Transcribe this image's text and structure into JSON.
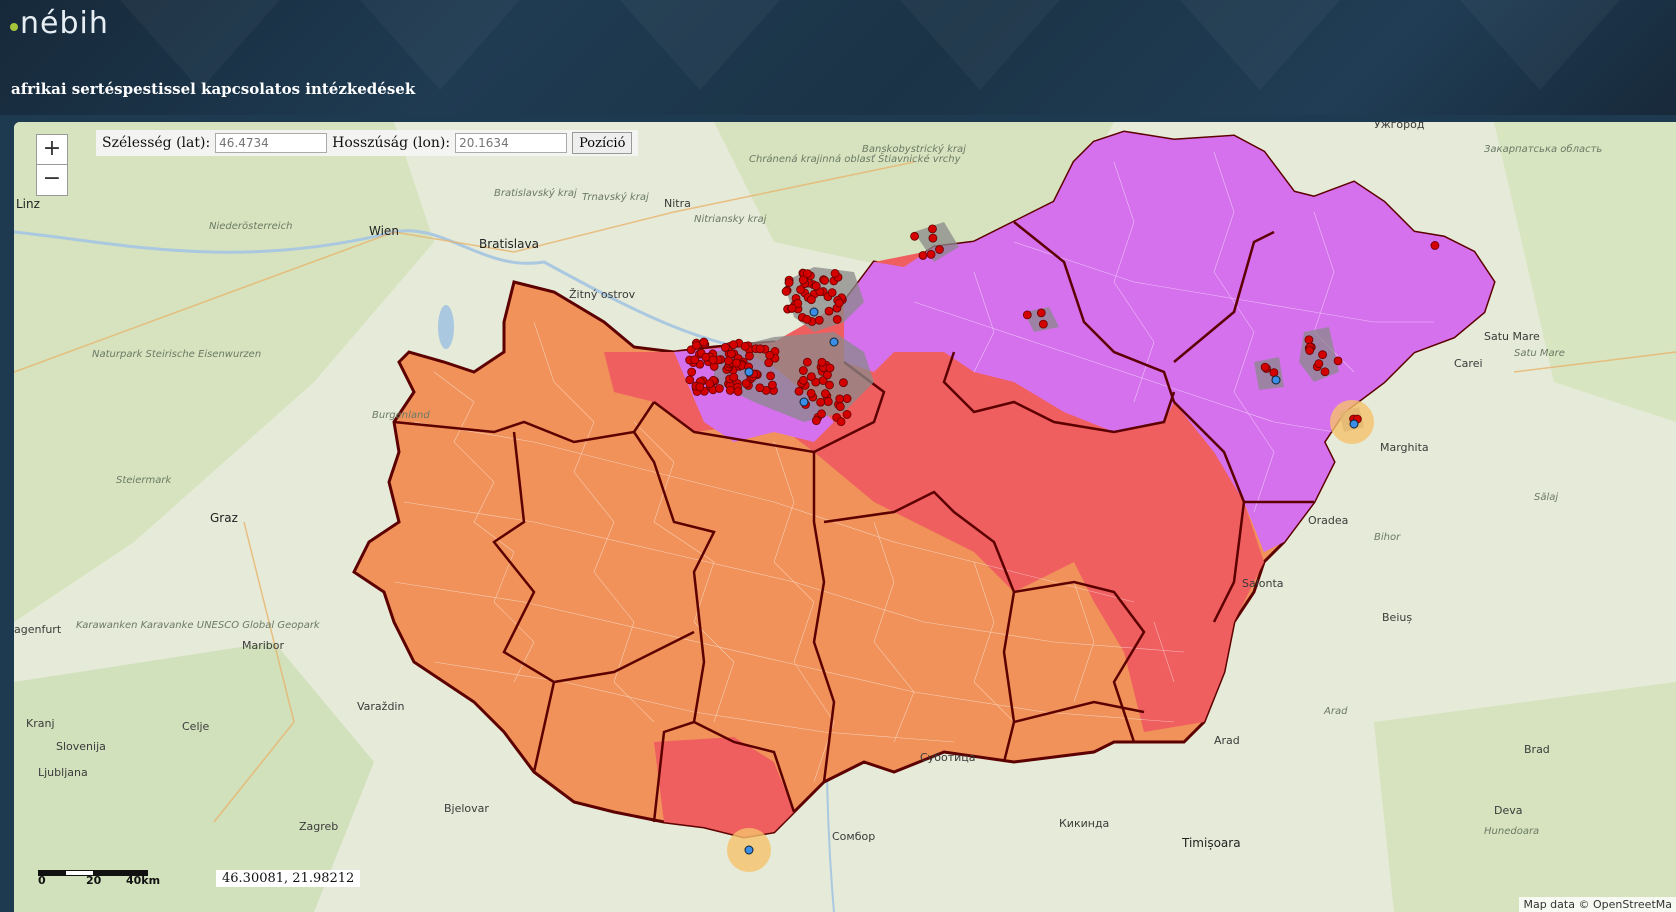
{
  "header": {
    "logo_text": "nébih",
    "subtitle": "afrikai sertéspestissel kapcsolatos intézkedések"
  },
  "map": {
    "zoom_in": "+",
    "zoom_out": "−",
    "lat_label": "Szélesség (lat):",
    "lat_placeholder": "46.4734",
    "lon_label": "Hosszúság (lon):",
    "lon_placeholder": "20.1634",
    "position_button": "Pozíció",
    "scale": {
      "zero": "0",
      "mid": "20",
      "end": "40km"
    },
    "cursor_coords": "46.30081, 21.98212",
    "attribution": "Map data © OpenStreetMa",
    "colors": {
      "zone_orange": "#f0925a",
      "zone_red": "#ef5f5f",
      "zone_purple": "#d671ee",
      "outbreak_red": "#d40000",
      "buffer_gray": "#8a8a8a",
      "border": "#5c0000"
    },
    "place_labels": {
      "linz": "Linz",
      "wien": "Wien",
      "bratislava": "Bratislava",
      "graz": "Graz",
      "maribor": "Maribor",
      "ljubljana": "Ljubljana",
      "slovenija": "Slovenija",
      "kranj": "Kranj",
      "celje": "Celje",
      "varazdin": "Varaždin",
      "bjelovar": "Bjelovar",
      "zagreb": "Zagreb",
      "klagenfurt": "agenfurt",
      "nitra": "Nitra",
      "uzhhorod": "Ужгород",
      "satu_mare": "Satu Mare",
      "carei": "Carei",
      "marghita": "Marghita",
      "oradea": "Oradea",
      "salonta": "Salonta",
      "beius": "Beiuș",
      "arad": "Arad",
      "timisoara": "Timișoara",
      "brad": "Brad",
      "deva": "Deva",
      "subotica": "Суботица",
      "sombor": "Сомбор",
      "kikinda": "Кикинда",
      "zitny_ostrov": "Žitný ostrov"
    },
    "region_labels": {
      "niederosterreich": "Niederösterreich",
      "burgenland": "Burgenland",
      "steiermark": "Steiermark",
      "bratislavsky": "Bratislavský kraj",
      "trnavsky": "Trnavský kraj",
      "nitriansky": "Nitriansky kraj",
      "banskobystricky": "Banskobystrický kraj",
      "zakarpatska": "Закарпатська область",
      "satu_mare_region": "Satu Mare",
      "salaj": "Sălaj",
      "bihor": "Bihor",
      "arad_region": "Arad",
      "hunedoara": "Hunedoara",
      "naturpark": "Naturpark Steirische Eisenwurzen",
      "chranena": "Chránená krajinná oblasť Štiavnické vrchy",
      "karawanken": "Karawanken Karavanke UNESCO Global Geopark"
    }
  }
}
